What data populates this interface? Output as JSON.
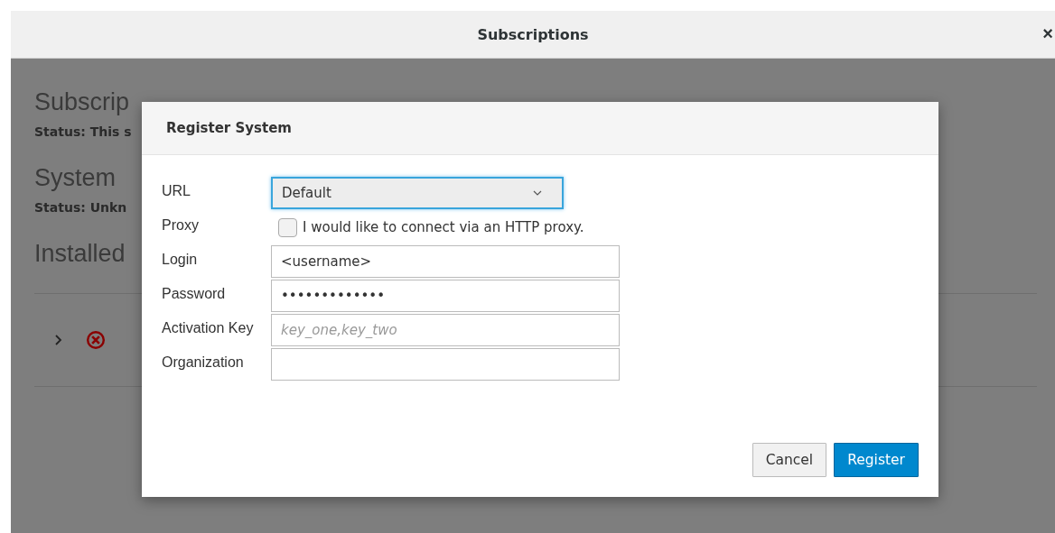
{
  "window": {
    "title": "Subscriptions",
    "close": "×"
  },
  "background": {
    "heading": "Subscrip",
    "status": "Status: This s",
    "section": "System",
    "section_status": "Status: Unkn",
    "installed": "Installed",
    "row": {
      "expanded": false,
      "error": true
    }
  },
  "dialog": {
    "title": "Register System",
    "fields": [
      {
        "kind": "select",
        "label": "URL",
        "value": "Default",
        "focused": true
      },
      {
        "kind": "checkbox",
        "label": "Proxy",
        "text": "I would like to connect via an HTTP proxy.",
        "checked": false
      },
      {
        "kind": "text",
        "label": "Login",
        "value": "<username>"
      },
      {
        "kind": "password",
        "label": "Password",
        "value": "•••••••••••••"
      },
      {
        "kind": "text",
        "label": "Activation Key",
        "placeholder": "key_one,key_two"
      },
      {
        "kind": "text",
        "label": "Organization"
      }
    ],
    "buttons": [
      {
        "label": "Cancel",
        "primary": false
      },
      {
        "label": "Register",
        "primary": true
      }
    ]
  }
}
